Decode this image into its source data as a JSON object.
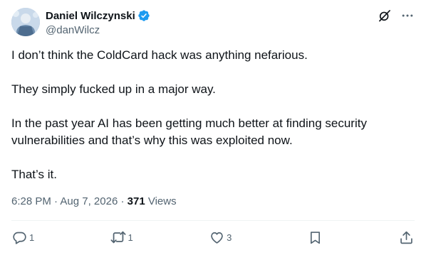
{
  "author": {
    "display_name": "Daniel Wilczynski",
    "handle": "@danWilcz",
    "verified": true,
    "verified_color": "#1d9bf0"
  },
  "tweet": {
    "paragraphs": [
      "I don’t think the ColdCard hack was anything nefarious.",
      "They simply fucked up in a major way.",
      "In the past year AI has been getting much better at finding security vulnerabilities and that’s why this was exploited now.",
      "That’s it."
    ]
  },
  "meta": {
    "time": "6:28 PM",
    "separator": " · ",
    "date": "Aug 7, 2026",
    "views_count": "371",
    "views_label": "Views"
  },
  "actions": {
    "reply_count": "1",
    "repost_count": "1",
    "like_count": "3"
  },
  "icons": {
    "top_left": "grok-icon",
    "top_right": "more-options-icon",
    "reply": "reply-icon",
    "repost": "repost-icon",
    "like": "heart-icon",
    "bookmark": "bookmark-icon",
    "share": "share-icon"
  },
  "colors": {
    "text": "#0f1419",
    "secondary": "#536471",
    "divider": "#eff3f4"
  }
}
